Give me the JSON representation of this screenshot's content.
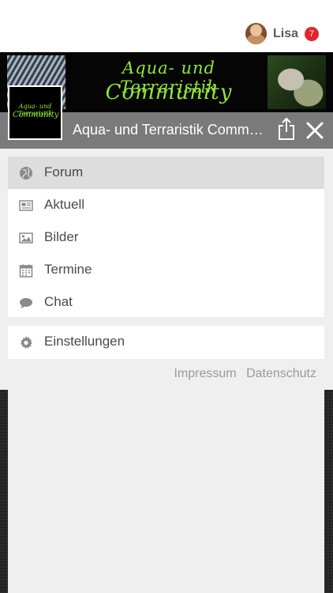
{
  "user": {
    "name": "Lisa",
    "notifications": "7"
  },
  "banner": {
    "title_line1": "Aqua- und Terraristik",
    "title_line2": "Community"
  },
  "forum": {
    "title": "Aqua- und Terraristik Community",
    "logo_line1": "Aqua- und Terraristik",
    "logo_line2": "Community"
  },
  "menu": {
    "items": [
      {
        "label": "Forum",
        "icon": "globe-icon",
        "active": true
      },
      {
        "label": "Aktuell",
        "icon": "newspaper-icon"
      },
      {
        "label": "Bilder",
        "icon": "image-icon"
      },
      {
        "label": "Termine",
        "icon": "calendar-icon"
      },
      {
        "label": "Chat",
        "icon": "chat-bubble-icon"
      }
    ],
    "settings": {
      "label": "Einstellungen",
      "icon": "gear-icon"
    }
  },
  "footer_links": {
    "impressum": "Impressum",
    "datenschutz": "Datenschutz"
  },
  "colors": {
    "header_gray": "#7a7a7a",
    "accent_green": "#8ee83a",
    "badge_red": "#e0252b",
    "active_row": "#dddddd"
  }
}
